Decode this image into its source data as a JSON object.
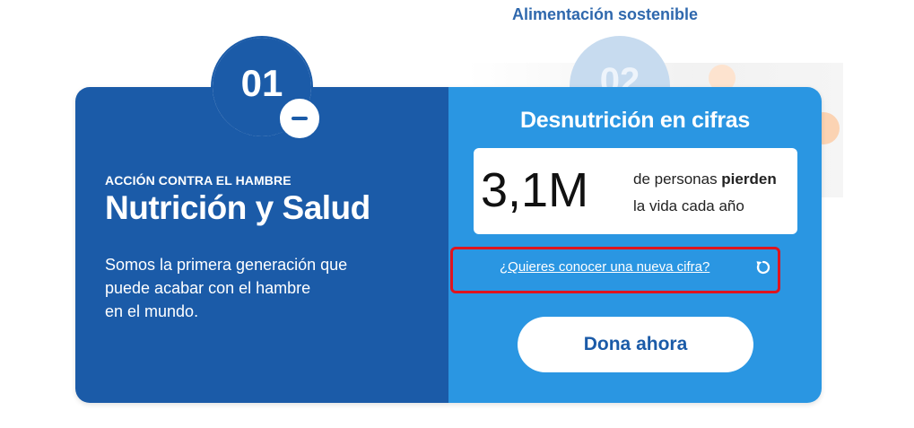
{
  "header": {
    "next_section_label": "Alimentación sostenible"
  },
  "steps": {
    "current_number": "01",
    "next_number": "02"
  },
  "left_panel": {
    "eyebrow": "ACCIÓN CONTRA EL HAMBRE",
    "title": "Nutrición y Salud",
    "description_lines": [
      "Somos la primera generación que",
      "puede acabar con el hambre",
      "en el mundo."
    ]
  },
  "right_panel": {
    "title": "Desnutrición en cifras",
    "stat": {
      "value": "3,1M",
      "text_line1_prefix": "de personas ",
      "text_line1_bold": "pierden",
      "text_line2": "la vida cada año"
    },
    "new_figure_link": "¿Quieres conocer una nueva cifra?",
    "donate_label": "Dona ahora"
  },
  "colors": {
    "brand_dark_blue": "#1b5ba8",
    "brand_light_blue": "#2a96e2",
    "highlight_red": "#e0141e"
  }
}
